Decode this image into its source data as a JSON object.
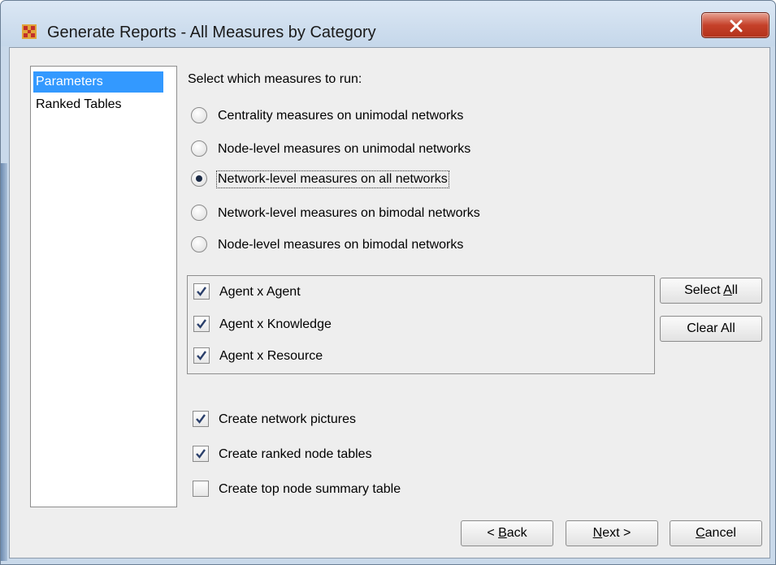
{
  "window": {
    "title": "Generate Reports - All Measures by Category",
    "app_icon": "grid-app-icon",
    "close_icon": "close-x-icon"
  },
  "nav": {
    "items": [
      {
        "label": "Parameters",
        "selected": true
      },
      {
        "label": "Ranked Tables",
        "selected": false
      }
    ]
  },
  "main": {
    "heading": "Select which measures to run:",
    "radios": [
      {
        "label": "Centrality measures on unimodal networks",
        "checked": false
      },
      {
        "label": "Node-level measures on unimodal networks",
        "checked": false
      },
      {
        "label": "Network-level measures on all networks",
        "checked": true
      },
      {
        "label": "Network-level measures on bimodal networks",
        "checked": false
      },
      {
        "label": "Node-level measures on bimodal networks",
        "checked": false
      }
    ],
    "networks": [
      {
        "label": "Agent x Agent",
        "checked": true
      },
      {
        "label": "Agent x Knowledge",
        "checked": true
      },
      {
        "label": "Agent x Resource",
        "checked": true
      }
    ],
    "select_all": {
      "pre": "Select ",
      "mnemonic": "A",
      "post": "ll"
    },
    "clear_all": {
      "label": "Clear All"
    },
    "options": [
      {
        "label": "Create network pictures",
        "checked": true
      },
      {
        "label": "Create ranked node tables",
        "checked": true
      },
      {
        "label": "Create top node summary table",
        "checked": false
      }
    ]
  },
  "footer": {
    "back": {
      "pre": "< ",
      "mnemonic": "B",
      "post": "ack"
    },
    "next": {
      "pre": "",
      "mnemonic": "N",
      "post": "ext >"
    },
    "cancel": {
      "pre": "",
      "mnemonic": "C",
      "post": "ancel"
    }
  },
  "colors": {
    "selection": "#3399ff",
    "close_button": "#c5412a",
    "window_frame": "#c9d9ea"
  }
}
